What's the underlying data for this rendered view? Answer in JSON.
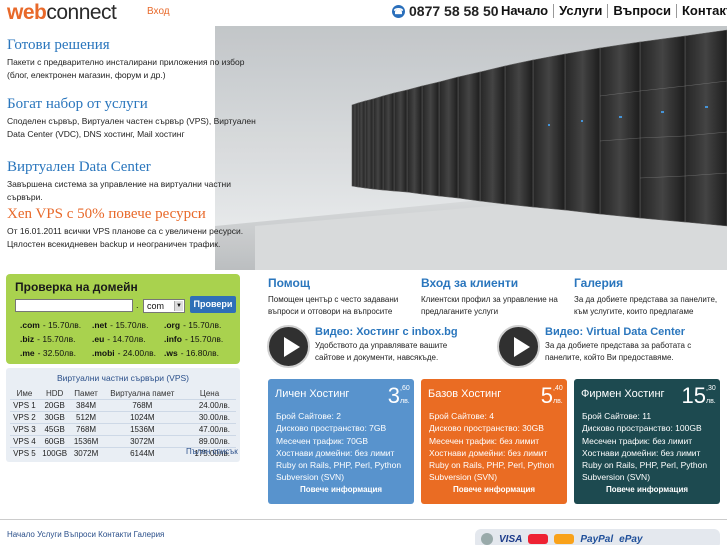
{
  "header": {
    "logo_web": "web",
    "logo_connect": "connect",
    "login": "Вход",
    "phone": "0877 58 58 50",
    "nav": [
      "Начало",
      "Услуги",
      "Въпроси",
      "Контакти"
    ]
  },
  "intro": [
    {
      "title": "Готови решения",
      "text": "Пакети с предварително инсталирани приложения по избор (блог, електронен магазин, форум и др.)"
    },
    {
      "title": "Богат набор от услуги",
      "text": "Споделен сървър, Виртуален частен сървър (VPS), Виртуален Data Center (VDC), DNS хостинг, Mail хостинг"
    },
    {
      "title": "Виртуален Data Center",
      "text": "Завършена система за управление на виртуални частни сървъри."
    },
    {
      "title": "Xen VPS с 50% повече ресурси",
      "text": "От 16.01.2011 всички VPS планове са с увеличени ресурси. Цялостен всекидневен backup и неограничен трафик."
    }
  ],
  "domain": {
    "title": "Проверка на домейн",
    "input_value": "",
    "dot": ".",
    "selected_tld": "com",
    "button": "Провери",
    "prices": [
      [
        {
          "tld": ".com",
          "price": "- 15.70лв."
        },
        {
          "tld": ".net",
          "price": "- 15.70лв."
        },
        {
          "tld": ".org",
          "price": "- 15.70лв."
        }
      ],
      [
        {
          "tld": ".biz",
          "price": "- 15.70лв."
        },
        {
          "tld": ".eu",
          "price": "- 14.70лв."
        },
        {
          "tld": ".info",
          "price": "- 15.70лв."
        }
      ],
      [
        {
          "tld": ".me",
          "price": "- 32.50лв."
        },
        {
          "tld": ".mobi",
          "price": "- 24.00лв."
        },
        {
          "tld": ".ws",
          "price": "- 16.80лв."
        }
      ]
    ]
  },
  "vps": {
    "title": "Виртуални частни сървъри (VPS)",
    "headers": [
      "Име",
      "HDD",
      "Памет",
      "Виртуална памет",
      "Цена"
    ],
    "rows": [
      [
        "VPS 1",
        "20GB",
        "384M",
        "768M",
        "24.00лв."
      ],
      [
        "VPS 2",
        "30GB",
        "512M",
        "1024M",
        "30.00лв."
      ],
      [
        "VPS 3",
        "45GB",
        "768M",
        "1536M",
        "47.00лв."
      ],
      [
        "VPS 4",
        "60GB",
        "1536M",
        "3072M",
        "89.00лв."
      ],
      [
        "VPS 5",
        "100GB",
        "3072M",
        "6144M",
        "175.00лв."
      ]
    ],
    "full_list": "Пълен списък"
  },
  "columns": [
    {
      "title": "Помощ",
      "text": "Помощен център с често задавани въпроси и отговори на въпросите"
    },
    {
      "title": "Вход за клиенти",
      "text": "Клиентски профил за управление на предлаганите услуги"
    },
    {
      "title": "Галерия",
      "text": "За да добиете представа за панелите, към услугите, които предлагаме"
    }
  ],
  "videos": [
    {
      "title": "Видео: Хостинг с inbox.bg",
      "text": "Удобството да управлявате вашите сайтове и документи, навсякъде."
    },
    {
      "title": "Видео: Virtual Data Center",
      "text": "За да добиете представа за работата с панелите, който Ви предоставяме."
    }
  ],
  "hosting": [
    {
      "name": "Личен Хостинг",
      "price": "3",
      "cents": ",60",
      "unit": "лв.",
      "features": [
        "Брой Сайтове: 2",
        "Дисково пространство: 7GB",
        "Месечен трафик: 70GB",
        "Хостнави домейни: без лимит",
        "Ruby on Rails, PHP, Perl, Python",
        "Subversion (SVN)"
      ],
      "more": "Повече информация",
      "color": "#5893cd"
    },
    {
      "name": "Базов Хостинг",
      "price": "5",
      "cents": ",40",
      "unit": "лв.",
      "features": [
        "Брой Сайтове: 4",
        "Дисково пространство: 30GB",
        "Месечен трафик: без лимит",
        "Хостнави домейни: без лимит",
        "Ruby on Rails, PHP, Perl, Python",
        "Subversion (SVN)"
      ],
      "more": "Повече информация",
      "color": "#ea6c23"
    },
    {
      "name": "Фирмен Хостинг",
      "price": "15",
      "cents": ",30",
      "unit": "лв.",
      "features": [
        "Брой Сайтове: 11",
        "Дисково пространство: 100GB",
        "Месечен трафик: без лимит",
        "Хостнави домейни: без лимит",
        "Ruby on Rails, PHP, Perl, Python",
        "Subversion (SVN)"
      ],
      "more": "Повече информация",
      "color": "#1d4a50"
    }
  ],
  "footer": {
    "nav": "Начало Услуги Въпроси Контакти Галерия",
    "payments": [
      "VISA",
      "PayPal",
      "ePay"
    ]
  }
}
